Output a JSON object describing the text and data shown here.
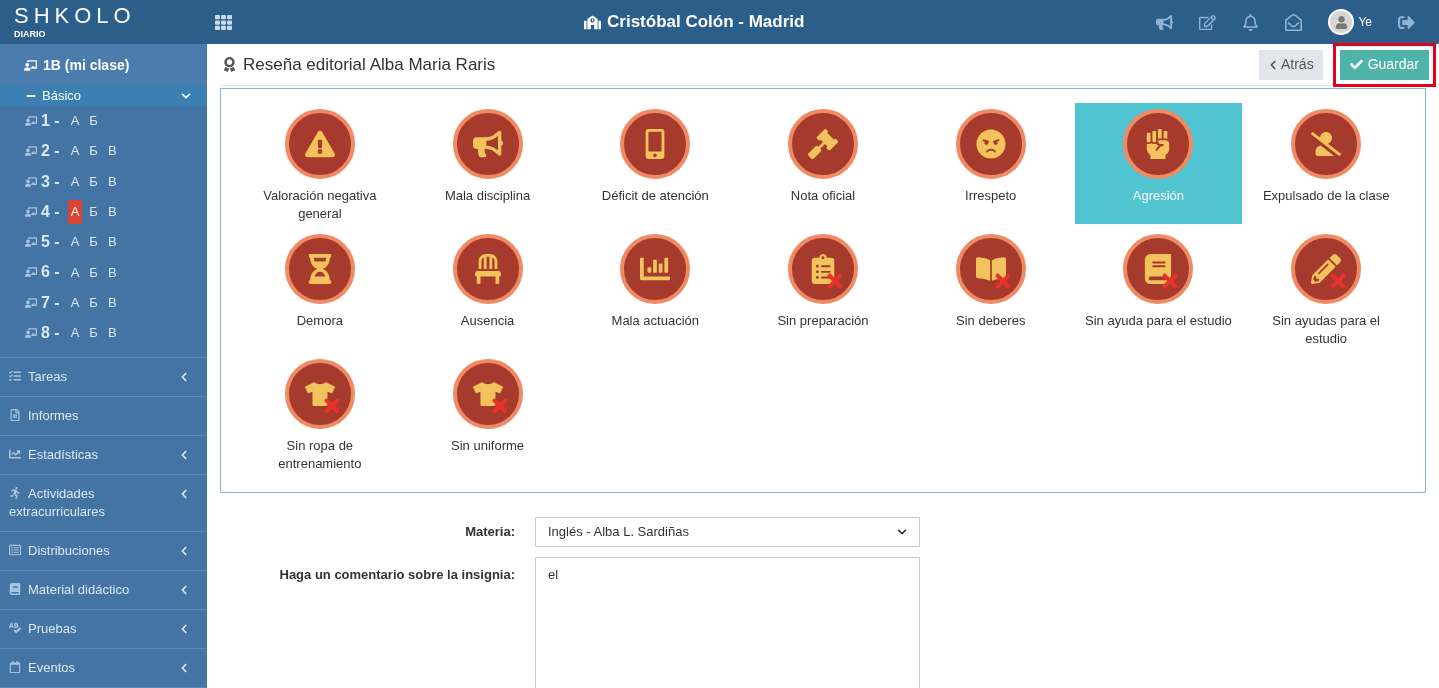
{
  "header": {
    "logo": "SHKOLO",
    "logo_subtitle": "DIARIO",
    "school": "Cristóbal Colón - Madrid",
    "user": "Ye"
  },
  "sidebar": {
    "class": "1B (mi clase)",
    "group": {
      "label": "Básico",
      "expanded": true
    },
    "grades": [
      {
        "number": "1 -",
        "sections": [
          {
            "label": "А",
            "selected": false
          },
          {
            "label": "Б",
            "selected": false
          }
        ]
      },
      {
        "number": "2 -",
        "sections": [
          {
            "label": "А",
            "selected": false
          },
          {
            "label": "Б",
            "selected": false
          },
          {
            "label": "В",
            "selected": false
          }
        ]
      },
      {
        "number": "3 -",
        "sections": [
          {
            "label": "А",
            "selected": false
          },
          {
            "label": "Б",
            "selected": false
          },
          {
            "label": "В",
            "selected": false
          }
        ]
      },
      {
        "number": "4 -",
        "sections": [
          {
            "label": "А",
            "selected": true
          },
          {
            "label": "Б",
            "selected": false
          },
          {
            "label": "В",
            "selected": false
          }
        ]
      },
      {
        "number": "5 -",
        "sections": [
          {
            "label": "А",
            "selected": false
          },
          {
            "label": "Б",
            "selected": false
          },
          {
            "label": "В",
            "selected": false
          }
        ]
      },
      {
        "number": "6 -",
        "sections": [
          {
            "label": "А",
            "selected": false
          },
          {
            "label": "Б",
            "selected": false
          },
          {
            "label": "В",
            "selected": false
          }
        ]
      },
      {
        "number": "7 -",
        "sections": [
          {
            "label": "А",
            "selected": false
          },
          {
            "label": "Б",
            "selected": false
          },
          {
            "label": "В",
            "selected": false
          }
        ]
      },
      {
        "number": "8 -",
        "sections": [
          {
            "label": "А",
            "selected": false
          },
          {
            "label": "Б",
            "selected": false
          },
          {
            "label": "В",
            "selected": false
          }
        ]
      }
    ],
    "items": [
      {
        "label": "Tareas",
        "expandable": true
      },
      {
        "label": "Informes",
        "expandable": false
      },
      {
        "label": "Estadísticas",
        "expandable": true
      },
      {
        "label": "Actividades extracurriculares",
        "expandable": true
      },
      {
        "label": "Distribuciones",
        "expandable": true
      },
      {
        "label": "Material didáctico",
        "expandable": true
      },
      {
        "label": "Pruebas",
        "expandable": true
      },
      {
        "label": "Eventos",
        "expandable": true
      }
    ]
  },
  "page": {
    "title": "Reseña editorial Alba Maria Raris",
    "back_button": "Atrás",
    "save_button": {
      "label": "Guardar",
      "highlighted": true
    }
  },
  "badges": [
    {
      "label": "Valoración negativa general",
      "selected": false
    },
    {
      "label": "Mala disciplina",
      "selected": false
    },
    {
      "label": "Déficit de atención",
      "selected": false
    },
    {
      "label": "Nota oficial",
      "selected": false
    },
    {
      "label": "Irrespeto",
      "selected": false
    },
    {
      "label": "Agresión",
      "selected": true
    },
    {
      "label": "Expulsado de la clase",
      "selected": false
    },
    {
      "label": "Demora",
      "selected": false
    },
    {
      "label": "Ausencia",
      "selected": false
    },
    {
      "label": "Mala actuación",
      "selected": false
    },
    {
      "label": "Sin preparación",
      "selected": false
    },
    {
      "label": "Sin deberes",
      "selected": false
    },
    {
      "label": "Sin ayuda para el estudio",
      "selected": false
    },
    {
      "label": "Sin ayudas para el estudio",
      "selected": false
    },
    {
      "label": "Sin ropa de entrenamiento",
      "selected": false
    },
    {
      "label": "Sin uniforme",
      "selected": false
    }
  ],
  "form": {
    "subject_label": "Materia:",
    "subject_value": "Inglés - Alba L. Sardiñas",
    "comment_label": "Haga un comentario sobre la insignia:",
    "comment_value": "el"
  }
}
